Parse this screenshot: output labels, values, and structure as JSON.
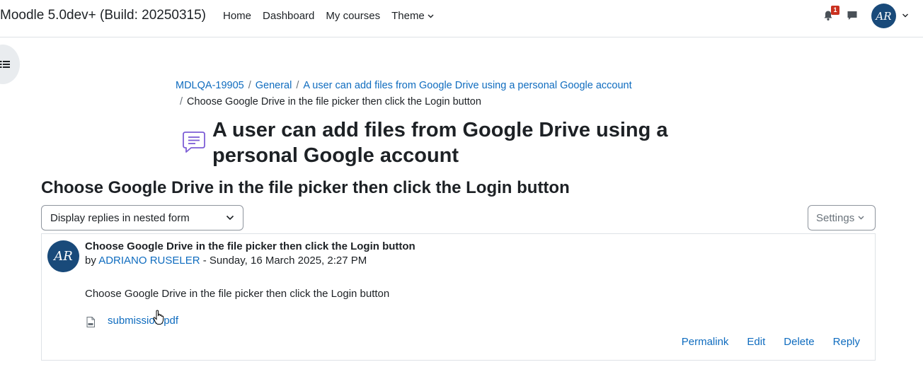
{
  "navbar": {
    "brand": "Moodle 5.0dev+ (Build: 20250315)",
    "links": [
      "Home",
      "Dashboard",
      "My courses"
    ],
    "theme_label": "Theme",
    "notification_count": "1",
    "avatar_initials": "AR"
  },
  "breadcrumb": {
    "items": [
      "MDLQA-19905",
      "General",
      "A user can add files from Google Drive using a personal Google account"
    ],
    "current": "Choose Google Drive in the file picker then click the Login button",
    "separator": "/"
  },
  "page": {
    "title": "A user can add files from Google Drive using a personal Google account",
    "discussion_title": "Choose Google Drive in the file picker then click the Login button",
    "display_mode": "Display replies in nested form",
    "settings_label": "Settings"
  },
  "post": {
    "avatar_initials": "AR",
    "subject": "Choose Google Drive in the file picker then click the Login button",
    "by_prefix": "by",
    "author": "ADRIANO RUSELER",
    "date": "- Sunday, 16 March 2025, 2:27 PM",
    "message": "Choose Google Drive in the file picker then click the Login button",
    "attachment": "submission.pdf",
    "actions": [
      "Permalink",
      "Edit",
      "Delete",
      "Reply"
    ]
  },
  "colors": {
    "link": "#0f6cbf",
    "avatar_bg": "#194a7a",
    "badge": "#ca3120",
    "border": "#dee2e6"
  }
}
